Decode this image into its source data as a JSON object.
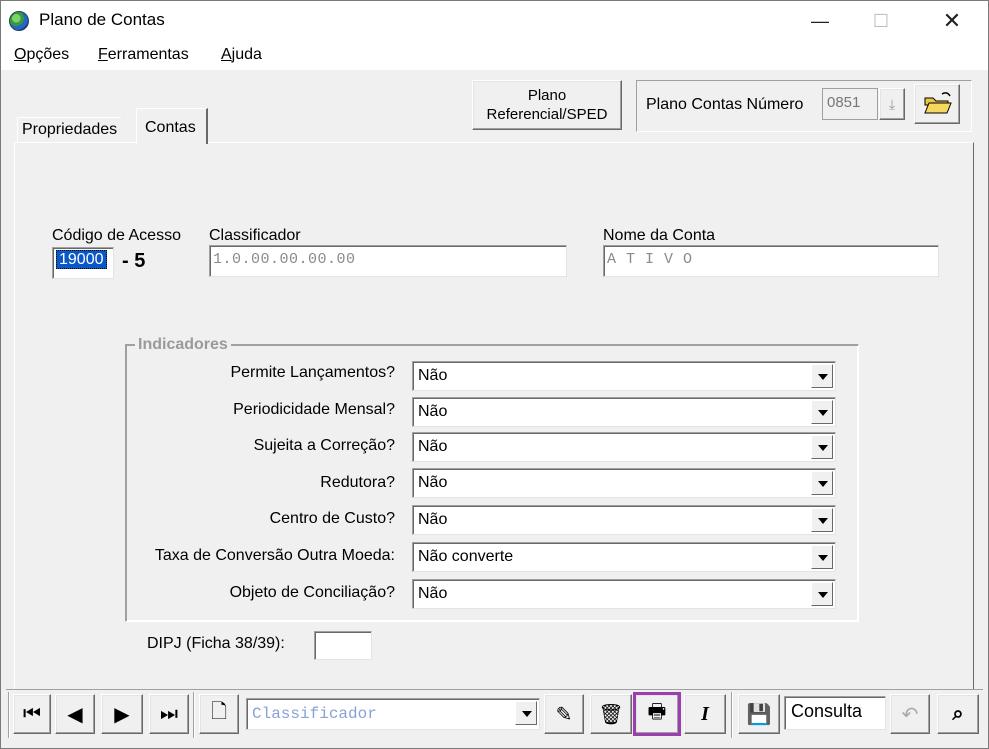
{
  "window": {
    "title": "Plano de Contas",
    "minimize": "—",
    "maximize": "☐",
    "close": "✕"
  },
  "menu": {
    "items": [
      {
        "first": "O",
        "rest": "pções"
      },
      {
        "first": "F",
        "rest": "erramentas"
      },
      {
        "first": "A",
        "rest": "juda"
      }
    ]
  },
  "header": {
    "plano_button_line1": "Plano",
    "plano_button_line2": "Referencial/SPED",
    "numero_label": "Plano Contas Número",
    "numero_value": "0851"
  },
  "tabs": [
    {
      "label": "Propriedades"
    },
    {
      "label": "Contas"
    }
  ],
  "form": {
    "codigo_label": "Código de Acesso",
    "codigo_value": "19000",
    "digito": "- 5",
    "classificador_label": "Classificador",
    "classificador_value": "1.0.00.00.00.00",
    "nome_label": "Nome da Conta",
    "nome_value": "A T I V O"
  },
  "indicadores": {
    "title": "Indicadores",
    "rows": [
      {
        "label": "Permite Lançamentos?",
        "value": "Não"
      },
      {
        "label": "Periodicidade Mensal?",
        "value": "Não"
      },
      {
        "label": "Sujeita a Correção?",
        "value": "Não"
      },
      {
        "label": "Redutora?",
        "value": "Não"
      },
      {
        "label": "Centro de Custo?",
        "value": "Não"
      },
      {
        "label": "Taxa de Conversão Outra Moeda:",
        "value": "Não converte"
      },
      {
        "label": "Objeto de Conciliação?",
        "value": "Não"
      }
    ]
  },
  "dipj": {
    "label": "DIPJ (Ficha 38/39):",
    "value": ""
  },
  "toolbar": {
    "search_placeholder": "Classificador",
    "mode": "Consulta",
    "icons": {
      "first": "⏮",
      "prev": "◀",
      "next": "▶",
      "last": "⏭",
      "new": "🗋",
      "edit": "✎",
      "delete": "🗑",
      "print": "🖶",
      "italic": "I",
      "save": "💾",
      "undo": "↶",
      "find": "⌕"
    }
  }
}
